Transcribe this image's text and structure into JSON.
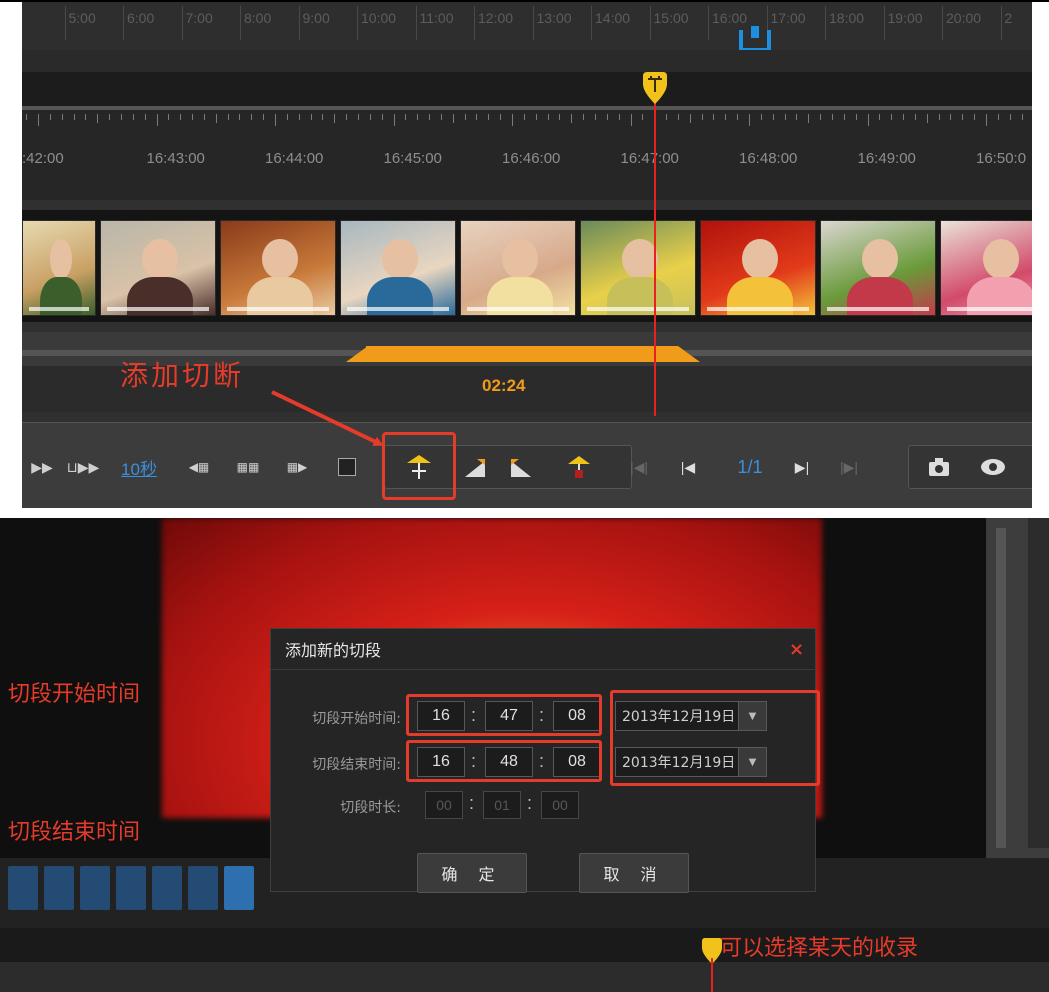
{
  "timeline": {
    "hour_labels": [
      "0",
      "5:00",
      "6:00",
      "7:00",
      "8:00",
      "9:00",
      "10:00",
      "11:00",
      "12:00",
      "13:00",
      "14:00",
      "15:00",
      "16:00",
      "17:00",
      "18:00",
      "19:00",
      "20:00",
      "2"
    ],
    "time_labels": [
      ":42:00",
      "16:43:00",
      "16:44:00",
      "16:45:00",
      "16:46:00",
      "16:47:00",
      "16:48:00",
      "16:49:00",
      "16:50:0"
    ],
    "clip_duration": "02:24",
    "annotation_add_cut": "添加切断"
  },
  "toolbar": {
    "step_link": "10秒",
    "page_indicator": "1/1"
  },
  "dialog": {
    "title": "添加新的切段",
    "close": "×",
    "start_label": "切段开始时间:",
    "end_label": "切段结束时间:",
    "duration_label": "切段时长:",
    "start_time": {
      "h": "16",
      "m": "47",
      "s": "08"
    },
    "end_time": {
      "h": "16",
      "m": "48",
      "s": "08"
    },
    "duration": {
      "h": "00",
      "m": "01",
      "s": "00"
    },
    "start_date": "2013年12月19日",
    "end_date": "2013年12月19日",
    "confirm_label": "确 定",
    "cancel_label": "取 消"
  },
  "annotations": {
    "start_time": "切段开始时间",
    "end_time": "切段结束时间",
    "select_day": "可以选择某天的收录"
  },
  "colors": {
    "accent_orange": "#f19b1a",
    "annotation_red": "#e53b2a",
    "link_blue": "#3a8fe0",
    "playhead_red": "#e82020"
  }
}
